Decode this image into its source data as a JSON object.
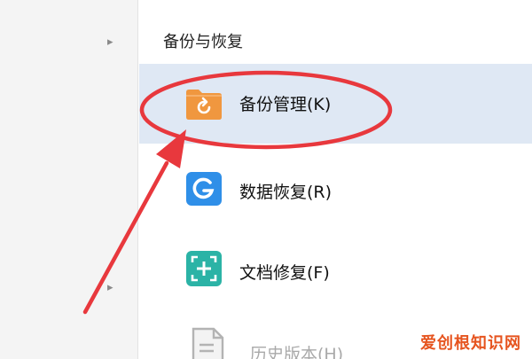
{
  "section": {
    "title": "备份与恢复"
  },
  "left_pane": {
    "arrow_glyph": "▸"
  },
  "menu": {
    "items": [
      {
        "label": "备份管理(K)",
        "icon": "backup-folder-icon",
        "active": true
      },
      {
        "label": "数据恢复(R)",
        "icon": "data-recovery-icon",
        "active": false
      },
      {
        "label": "文档修复(F)",
        "icon": "document-repair-icon",
        "active": false
      },
      {
        "label": "历史版本(H)",
        "icon": "history-version-icon",
        "active": false
      }
    ]
  },
  "watermark": {
    "text": "爱创根知识网"
  },
  "colors": {
    "active_row": "#dfe8f4",
    "annotation_red": "#e8383d",
    "folder_orange": "#f0973f",
    "recovery_blue": "#2f8fe8",
    "repair_teal": "#2bb3a6"
  }
}
